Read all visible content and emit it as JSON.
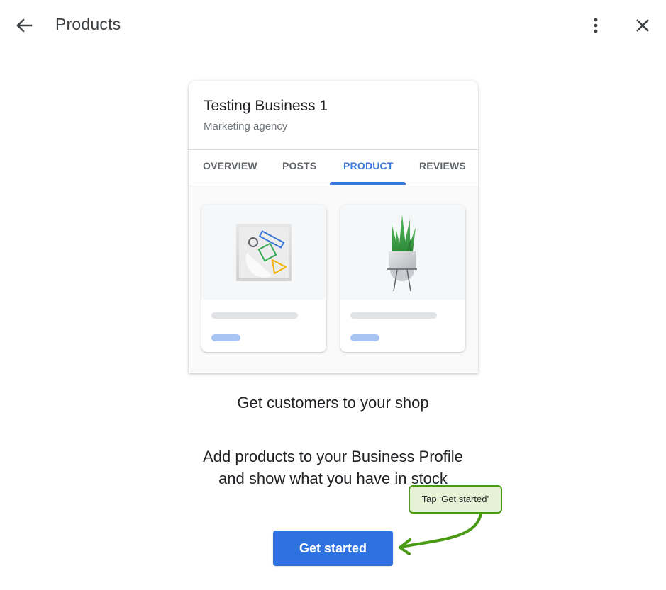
{
  "header": {
    "title": "Products",
    "back_icon": "arrow-left-icon",
    "more_icon": "more-vert-icon",
    "close_icon": "close-icon"
  },
  "preview_card": {
    "business_name": "Testing Business 1",
    "business_category": "Marketing agency",
    "tabs": [
      {
        "label": "OVERVIEW",
        "active": false
      },
      {
        "label": "POSTS",
        "active": false
      },
      {
        "label": "PRODUCT",
        "active": true
      },
      {
        "label": "REVIEWS",
        "active": false
      }
    ],
    "products": [
      {
        "image": "geometric-art-icon"
      },
      {
        "image": "potted-plant-icon"
      }
    ]
  },
  "content": {
    "headline": "Get customers to your shop",
    "description_line1": "Add products to your Business Profile",
    "description_line2": "and show what you have in stock",
    "cta_label": "Get started"
  },
  "annotation": {
    "hint_text": "Tap ‘Get started’"
  },
  "colors": {
    "accent": "#3b78d8",
    "button": "#2e72e0",
    "hint_border": "#4a9a13",
    "hint_fill": "#e6f2d5"
  }
}
